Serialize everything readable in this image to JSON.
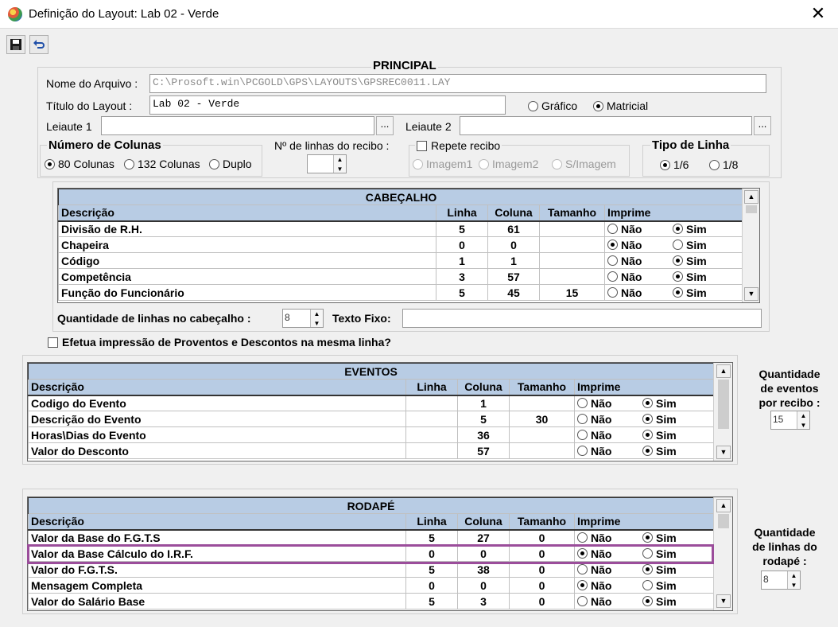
{
  "window": {
    "title": "Definição do Layout: Lab 02 - Verde",
    "close": "✕"
  },
  "toolbar": {
    "save_icon": "floppy-disk-icon",
    "undo_icon": "undo-icon"
  },
  "principal": {
    "title": "PRINCIPAL",
    "nome_arquivo_label": "Nome do Arquivo :",
    "nome_arquivo_value": "C:\\Prosoft.win\\PCGOLD\\GPS\\LAYOUTS\\GPSREC0011.LAY",
    "titulo_label": "Título do Layout :",
    "titulo_value": "Lab 02 - Verde",
    "grafico": "Gráfico",
    "matricial": "Matricial",
    "leiaute1_label": "Leiaute 1",
    "leiaute2_label": "Leiaute 2",
    "ellipsis": "...",
    "num_colunas_title": "Número de Colunas",
    "col80": "80 Colunas",
    "col132": "132 Colunas",
    "duplo": "Duplo",
    "linhas_recibo_label": "Nº de linhas do recibo :",
    "repete_recibo": "Repete recibo",
    "imagem1": "Imagem1",
    "imagem2": "Imagem2",
    "simagem": "S/Imagem",
    "tipo_linha_title": "Tipo de Linha",
    "tl16": "1/6",
    "tl18": "1/8"
  },
  "grid_headers": {
    "descricao": "Descrição",
    "linha": "Linha",
    "coluna": "Coluna",
    "tamanho": "Tamanho",
    "imprime": "Imprime",
    "nao": "Não",
    "sim": "Sim"
  },
  "cabecalho": {
    "title": "CABEÇALHO",
    "rows": [
      {
        "desc": "Divisão de R.H.",
        "linha": "5",
        "coluna": "61",
        "tamanho": "",
        "imprime": "sim"
      },
      {
        "desc": "Chapeira",
        "linha": "0",
        "coluna": "0",
        "tamanho": "",
        "imprime": "nao"
      },
      {
        "desc": "Código",
        "linha": "1",
        "coluna": "1",
        "tamanho": "",
        "imprime": "sim"
      },
      {
        "desc": "Competência",
        "linha": "3",
        "coluna": "57",
        "tamanho": "",
        "imprime": "sim"
      },
      {
        "desc": "Função do Funcionário",
        "linha": "5",
        "coluna": "45",
        "tamanho": "15",
        "imprime": "sim"
      }
    ],
    "qtd_linhas_label": "Quantidade de linhas no cabeçalho :",
    "qtd_linhas_value": "8",
    "texto_fixo_label": "Texto Fixo:"
  },
  "efetua_label": "Efetua impressão de Proventos e Descontos na mesma linha?",
  "eventos": {
    "title": "EVENTOS",
    "rows": [
      {
        "desc": "Codigo do Evento",
        "linha": "",
        "coluna": "1",
        "tamanho": "",
        "imprime": "sim"
      },
      {
        "desc": "Descrição do Evento",
        "linha": "",
        "coluna": "5",
        "tamanho": "30",
        "imprime": "sim"
      },
      {
        "desc": "Horas\\Dias do Evento",
        "linha": "",
        "coluna": "36",
        "tamanho": "",
        "imprime": "sim"
      },
      {
        "desc": "Valor do Desconto",
        "linha": "",
        "coluna": "57",
        "tamanho": "",
        "imprime": "sim"
      }
    ],
    "qtd_label_1": "Quantidade",
    "qtd_label_2": "de eventos",
    "qtd_label_3": "por recibo :",
    "qtd_value": "15"
  },
  "rodape": {
    "title": "RODAPÉ",
    "rows": [
      {
        "desc": "Valor da Base do F.G.T.S",
        "linha": "5",
        "coluna": "27",
        "tamanho": "0",
        "imprime": "sim"
      },
      {
        "desc": "Valor da Base Cálculo do I.R.F.",
        "linha": "0",
        "coluna": "0",
        "tamanho": "0",
        "imprime": "nao"
      },
      {
        "desc": "Valor do F.G.T.S.",
        "linha": "5",
        "coluna": "38",
        "tamanho": "0",
        "imprime": "sim"
      },
      {
        "desc": "Mensagem Completa",
        "linha": "0",
        "coluna": "0",
        "tamanho": "0",
        "imprime": "nao"
      },
      {
        "desc": "Valor do Salário Base",
        "linha": "5",
        "coluna": "3",
        "tamanho": "0",
        "imprime": "sim"
      }
    ],
    "qtd_label_1": "Quantidade",
    "qtd_label_2": "de linhas do",
    "qtd_label_3": "rodapé :",
    "qtd_value": "8"
  },
  "colors": {
    "header_bg": "#b8cce4",
    "highlight": "#9b4d9b"
  }
}
